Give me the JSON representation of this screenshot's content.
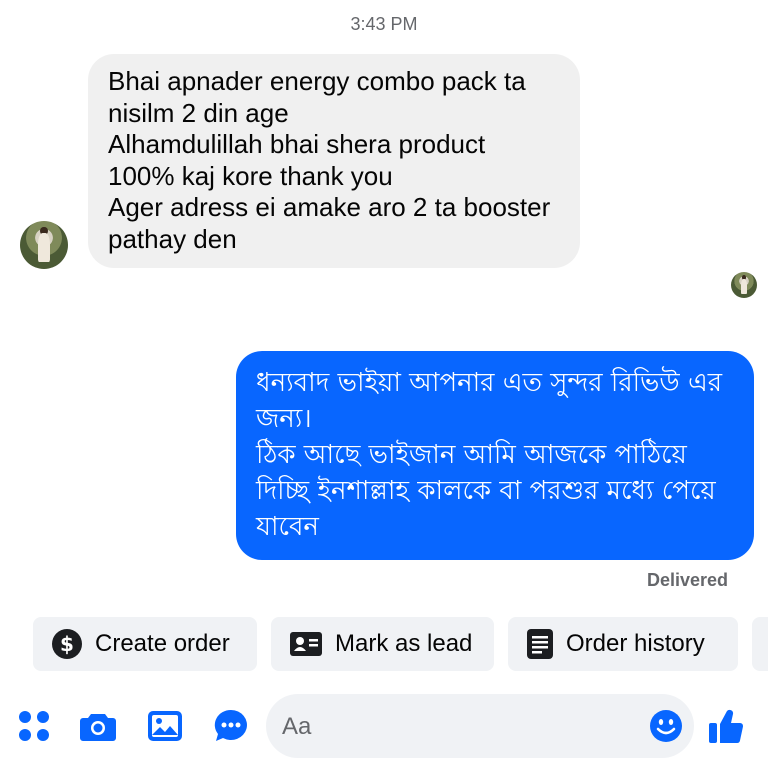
{
  "conversation": {
    "timestamp": "3:43 PM",
    "incoming_message": "Bhai apnader energy combo pack ta\nnisilm 2 din age\nAlhamdulillah bhai shera product\n100% kaj kore thank you\nAger adress ei amake aro 2 ta booster\npathay den",
    "outgoing_message": "ধন্যবাদ ভাইয়া আপনার এত সুন্দর রিভিউ এর\nজন্য।\nঠিক আছে ভাইজান আমি আজকে পাঠিয়ে\nদিচ্ছি ইনশাল্লাহ কালকে বা পরশুর মধ্যে পেয়ে\nযাবেন",
    "status": "Delivered"
  },
  "actions": {
    "create_order": "Create order",
    "mark_as_lead": "Mark as lead",
    "order_history": "Order history"
  },
  "composer": {
    "placeholder": "Aa"
  },
  "colors": {
    "accent": "#0866ff",
    "incoming_bubble": "#f0f0f0",
    "chip_bg": "#f0f2f5",
    "muted_text": "#65676b"
  },
  "icons": {
    "create_order": "dollar-circle-icon",
    "mark_as_lead": "contact-card-icon",
    "order_history": "receipt-icon",
    "menu": "four-dots-icon",
    "camera": "camera-icon",
    "photo": "image-icon",
    "chat": "chat-bubble-icon",
    "emoji": "emoji-icon",
    "like": "thumbs-up-icon"
  }
}
